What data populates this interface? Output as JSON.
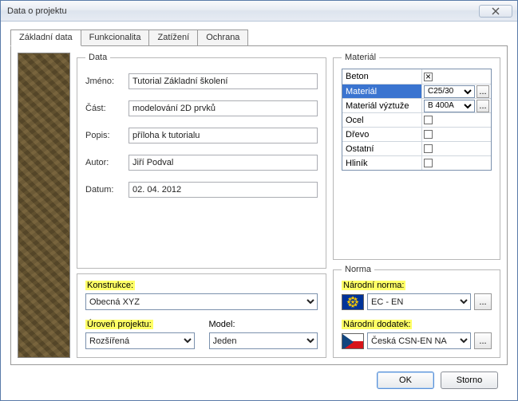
{
  "window": {
    "title": "Data o projektu"
  },
  "tabs": [
    "Základní data",
    "Funkcionalita",
    "Zatížení",
    "Ochrana"
  ],
  "active_tab": 0,
  "data_group": {
    "legend": "Data",
    "name_label": "Jméno:",
    "name_value": "Tutorial Základní školení",
    "part_label": "Část:",
    "part_value": "modelování 2D prvků",
    "desc_label": "Popis:",
    "desc_value": "příloha k tutorialu",
    "author_label": "Autor:",
    "author_value": "Jiří Podval",
    "date_label": "Datum:",
    "date_value": "02. 04. 2012"
  },
  "construction": {
    "label": "Konstrukce:",
    "value": "Obecná XYZ"
  },
  "level": {
    "label": "Úroveň projektu:",
    "value": "Rozšířená"
  },
  "model": {
    "label": "Model:",
    "value": "Jeden"
  },
  "material": {
    "legend": "Materiál",
    "rows": [
      {
        "name": "Beton",
        "checked": true,
        "mark": "x"
      },
      {
        "name": "Materiál",
        "selected": true,
        "value": "C25/30",
        "has_combo": true
      },
      {
        "name": "Materiál výztuže",
        "value": "B 400A",
        "has_combo": true
      },
      {
        "name": "Ocel",
        "checked": false
      },
      {
        "name": "Dřevo",
        "checked": false
      },
      {
        "name": "Ostatní",
        "checked": false
      },
      {
        "name": "Hliník",
        "checked": false
      }
    ]
  },
  "norm": {
    "legend": "Norma",
    "national_label": "Národní norma:",
    "national_value": "EC - EN",
    "annex_label": "Národní dodatek:",
    "annex_value": "Česká CSN-EN NA"
  },
  "buttons": {
    "ok": "OK",
    "cancel": "Storno",
    "ellipsis": "..."
  }
}
